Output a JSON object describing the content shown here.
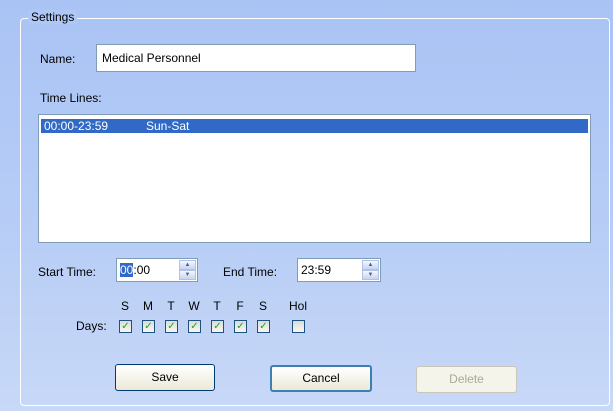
{
  "group": {
    "title": "Settings"
  },
  "name": {
    "label": "Name:",
    "value": "Medical Personnel"
  },
  "timelines": {
    "label": "Time Lines:",
    "rows": [
      {
        "time": "00:00-23:59",
        "days": "Sun-Sat",
        "selected": true
      }
    ]
  },
  "start_time": {
    "label": "Start Time:",
    "hours": "00",
    "rest": ":00"
  },
  "end_time": {
    "label": "End Time:",
    "value": "23:59"
  },
  "days": {
    "label": "Days:",
    "letters": [
      "S",
      "M",
      "T",
      "W",
      "T",
      "F",
      "S"
    ],
    "checked": [
      true,
      true,
      true,
      true,
      true,
      true,
      true
    ],
    "hol_label": "Hol",
    "hol_checked": false
  },
  "buttons": {
    "save": "Save",
    "cancel": "Cancel",
    "delete": "Delete",
    "delete_enabled": false
  },
  "icons": {
    "spin_up": "spin-up-icon",
    "spin_down": "spin-down-icon",
    "check": "check-icon"
  },
  "colors": {
    "selection": "#3169c6",
    "panel": "#aec7f5",
    "check": "#21a121"
  }
}
